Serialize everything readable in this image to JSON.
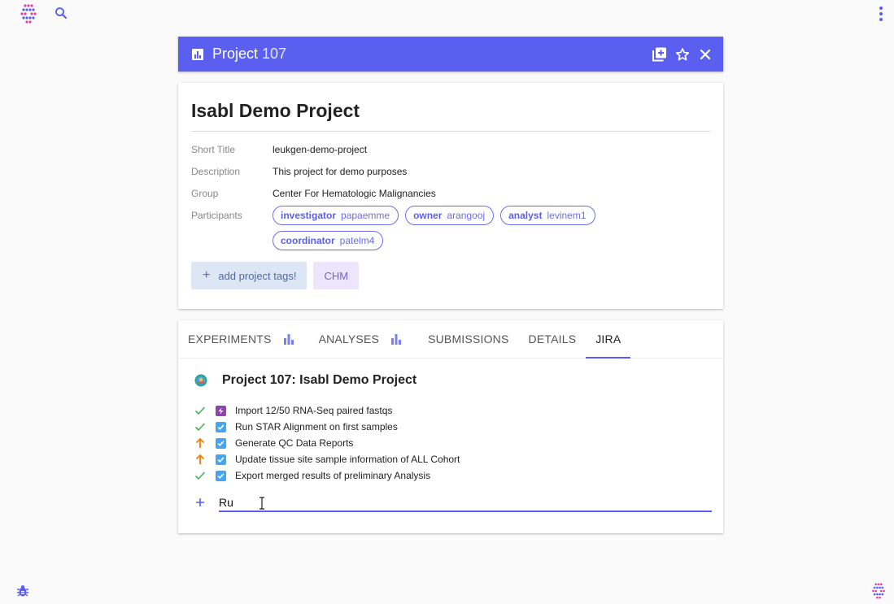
{
  "header": {
    "title": "Project",
    "number": "107",
    "icons": [
      "bar-chart-icon",
      "add-to-library-icon",
      "star-outline-icon",
      "close-icon"
    ]
  },
  "project": {
    "title": "Isabl Demo Project",
    "fields": {
      "short_title_label": "Short Title",
      "short_title": "leukgen-demo-project",
      "description_label": "Description",
      "description": "This project for demo purposes",
      "group_label": "Group",
      "group": "Center For Hematologic Malignancies",
      "participants_label": "Participants"
    },
    "participants": [
      {
        "role": "investigator",
        "user": "papaemme"
      },
      {
        "role": "owner",
        "user": "arangooj"
      },
      {
        "role": "analyst",
        "user": "levinem1"
      },
      {
        "role": "coordinator",
        "user": "patelm4"
      }
    ],
    "add_tags_label": "add project tags!",
    "tags": [
      "CHM"
    ]
  },
  "tabs": [
    {
      "label": "EXPERIMENTS",
      "icon": "bar-chart-icon"
    },
    {
      "label": "ANALYSES",
      "icon": "bar-chart-icon"
    },
    {
      "label": "SUBMISSIONS"
    },
    {
      "label": "DETAILS"
    },
    {
      "label": "JIRA",
      "active": true
    }
  ],
  "jira": {
    "title": "Project 107: Isabl Demo Project",
    "issues": [
      {
        "status": "done",
        "type": "epic",
        "summary": "Import 12/50 RNA-Seq paired fastqs"
      },
      {
        "status": "done",
        "type": "task",
        "summary": "Run STAR Alignment on first samples"
      },
      {
        "status": "in-progress",
        "type": "task",
        "summary": "Generate QC Data Reports"
      },
      {
        "status": "in-progress",
        "type": "task",
        "summary": "Update tissue site sample information of ALL Cohort"
      },
      {
        "status": "done",
        "type": "task",
        "summary": "Export merged results of preliminary Analysis"
      }
    ],
    "new_issue_value": "Ru"
  },
  "colors": {
    "accent": "#5b5ff0",
    "done": "#4caf50",
    "in_progress": "#f57c00",
    "task": "#42a5f5",
    "epic": "#8e44ad"
  }
}
